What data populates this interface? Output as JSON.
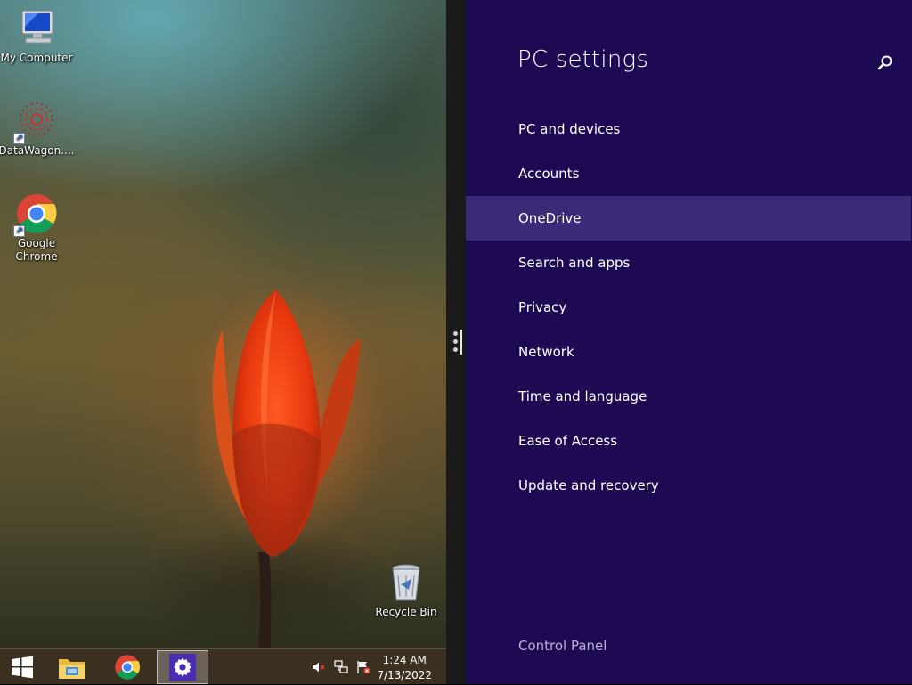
{
  "desktop": {
    "icons": {
      "my_computer": "My Computer",
      "datawagon": "DataWagon....",
      "chrome_line1": "Google",
      "chrome_line2": "Chrome",
      "recycle_bin": "Recycle Bin"
    }
  },
  "taskbar": {
    "buttons": [
      "start-icon",
      "file-explorer-icon",
      "chrome-icon",
      "pc-settings-icon"
    ],
    "active_button": "pc-settings-icon",
    "tray_icons": [
      "volume-muted-icon",
      "network-icon",
      "action-center-flag-icon"
    ],
    "clock": {
      "time": "1:24 AM",
      "date": "7/13/2022"
    }
  },
  "settings": {
    "title": "PC settings",
    "items": [
      {
        "label": "PC and devices"
      },
      {
        "label": "Accounts"
      },
      {
        "label": "OneDrive",
        "selected": true
      },
      {
        "label": "Search and apps"
      },
      {
        "label": "Privacy"
      },
      {
        "label": "Network"
      },
      {
        "label": "Time and language"
      },
      {
        "label": "Ease of Access"
      },
      {
        "label": "Update and recovery"
      }
    ],
    "footer_link": "Control Panel"
  },
  "colors": {
    "settings_background": "#1e0a52",
    "settings_selected": "#3b2a78",
    "taskbar": "#3b2f20"
  }
}
